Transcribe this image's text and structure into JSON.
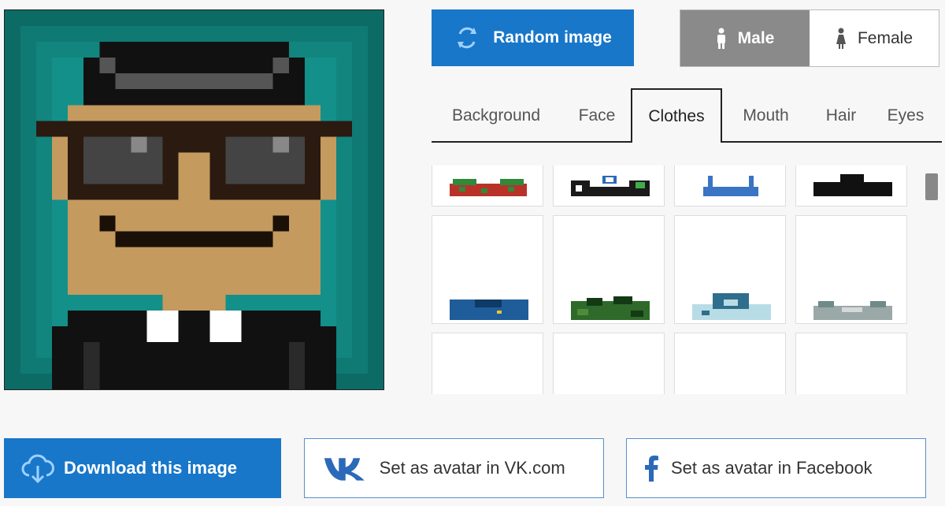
{
  "actions": {
    "random_label": "Random image",
    "download_label": "Download this image",
    "vk_label": "Set as avatar in VK.com",
    "facebook_label": "Set as avatar in Facebook"
  },
  "gender": {
    "options": [
      {
        "label": "Male",
        "icon": "male-figure-icon",
        "selected": true
      },
      {
        "label": "Female",
        "icon": "female-figure-icon",
        "selected": false
      }
    ]
  },
  "tabs": [
    {
      "label": "Background",
      "active": false
    },
    {
      "label": "Face",
      "active": false
    },
    {
      "label": "Clothes",
      "active": true
    },
    {
      "label": "Mouth",
      "active": false
    },
    {
      "label": "Hair",
      "active": false
    },
    {
      "label": "Eyes",
      "active": false
    }
  ],
  "clothes_items": [
    {
      "name": "red-green-checked-shirt"
    },
    {
      "name": "white-blue-green-collared-shirt"
    },
    {
      "name": "blue-overalls"
    },
    {
      "name": "black-top"
    },
    {
      "name": "blue-collared-jacket"
    },
    {
      "name": "green-camouflage-shirt"
    },
    {
      "name": "light-blue-patterned-shirt"
    },
    {
      "name": "grey-teal-shirt"
    },
    {
      "name": "empty"
    },
    {
      "name": "empty"
    },
    {
      "name": "empty"
    },
    {
      "name": "empty"
    }
  ],
  "colors": {
    "accent": "#1877c9",
    "toggle_active": "#8a8a8a",
    "avatar_background": "#0a5a55",
    "skin": "#c49a5e"
  },
  "icons": {
    "random": "refresh-icon",
    "download": "cloud-download-icon",
    "vk": "vk-logo-icon",
    "facebook": "facebook-logo-icon"
  }
}
